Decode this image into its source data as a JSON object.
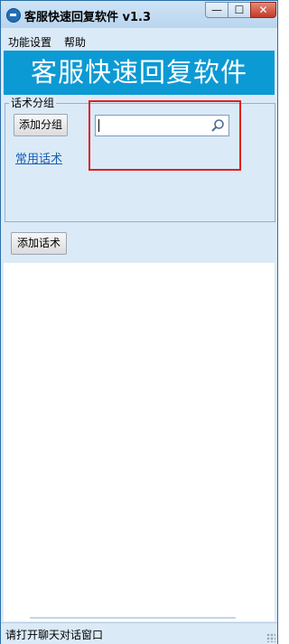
{
  "window": {
    "title": "客服快速回复软件 v1.3",
    "controls": {
      "minimize": "—",
      "maximize": "☐",
      "close": "✕"
    }
  },
  "menu": {
    "items": [
      "功能设置",
      "帮助"
    ]
  },
  "banner": {
    "text": "客服快速回复软件"
  },
  "phrase_group": {
    "legend": "话术分组",
    "add_group_label": "添加分组",
    "common_link": "常用话术",
    "search": {
      "value": "",
      "placeholder": ""
    }
  },
  "add_phrase_label": "添加话术",
  "status": {
    "text": "请打开聊天对话窗口"
  },
  "colors": {
    "banner_bg": "#0c9ad4",
    "window_bg": "#dbeaf7",
    "highlight": "#e02020",
    "link": "#1a5fb4"
  },
  "icons": [
    "app-icon",
    "search-icon",
    "minimize-icon",
    "maximize-icon",
    "close-icon",
    "resize-grip-icon"
  ]
}
